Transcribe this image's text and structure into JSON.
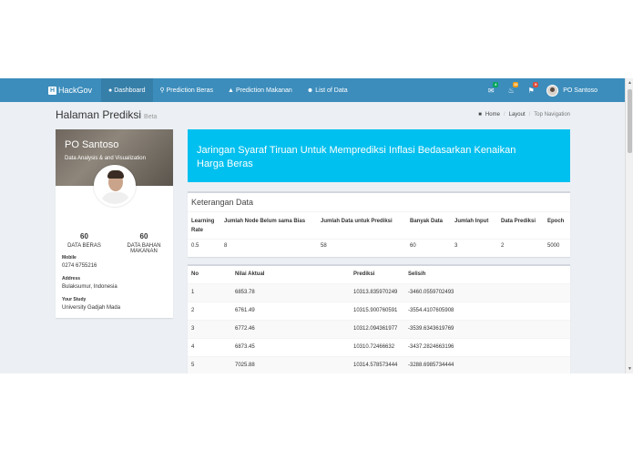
{
  "navbar": {
    "brand": "HackGov",
    "brand_logo": "H",
    "items": [
      {
        "label": "Dashboard",
        "icon": "dashboard-icon"
      },
      {
        "label": "Prediction Beras",
        "icon": "map-marker-icon"
      },
      {
        "label": "Prediction Makanan",
        "icon": "area-chart-icon"
      },
      {
        "label": "List of Data",
        "icon": "users-icon"
      }
    ],
    "notifications": [
      {
        "icon": "envelope-icon",
        "count": "4",
        "color": "#00a65a"
      },
      {
        "icon": "bell-icon",
        "count": "10",
        "color": "#f39c12"
      },
      {
        "icon": "flag-icon",
        "count": "9",
        "color": "#dd4b39"
      }
    ],
    "user_name": "PO Santoso"
  },
  "header": {
    "title": "Halaman Prediksi",
    "subtitle": "Beta",
    "breadcrumb": {
      "home": "Home",
      "layout": "Layout",
      "current": "Top Navigation"
    }
  },
  "profile": {
    "name": "PO Santoso",
    "description": "Data Analysis & and Visualization",
    "stats": [
      {
        "value": "60",
        "label": "DATA BERAS"
      },
      {
        "value": "60",
        "label_line1": "DATA BAHAN",
        "label_line2": "MAKANAN"
      }
    ],
    "mobile_label": "Mobile",
    "mobile": "0274 6755216",
    "address_label": "Address",
    "address": "Bulaksumur, Indonesia",
    "study_label": "Your Study",
    "study": "University Gadjah Mada"
  },
  "banner": {
    "line1": "Jaringan Syaraf Tiruan Untuk Memprediksi Inflasi Bedasarkan Kenaikan",
    "line2": "Harga Beras"
  },
  "keterangan": {
    "title": "Keterangan Data",
    "headers": [
      "Learning Rate",
      "Jumlah Node Belum sama Bias",
      "Jumlah Data untuk Prediksi",
      "Banyak Data",
      "Jumlah Input",
      "Data Prediksi",
      "Epoch"
    ],
    "values": [
      "0.5",
      "8",
      "58",
      "60",
      "3",
      "2",
      "5000"
    ]
  },
  "prediksi": {
    "headers": [
      "No",
      "Nilai Aktual",
      "Prediksi",
      "Selisih"
    ],
    "rows": [
      [
        "1",
        "6853.78",
        "10313.835970249",
        "-3460.0559702493"
      ],
      [
        "2",
        "6761.49",
        "10315.900760591",
        "-3554.4107605908"
      ],
      [
        "3",
        "6772.46",
        "10312.094361977",
        "-3539.6343619769"
      ],
      [
        "4",
        "6873.45",
        "10310.72466632",
        "-3437.2824663196"
      ],
      [
        "5",
        "7025.88",
        "10314.578573444",
        "-3288.6985734444"
      ]
    ]
  }
}
